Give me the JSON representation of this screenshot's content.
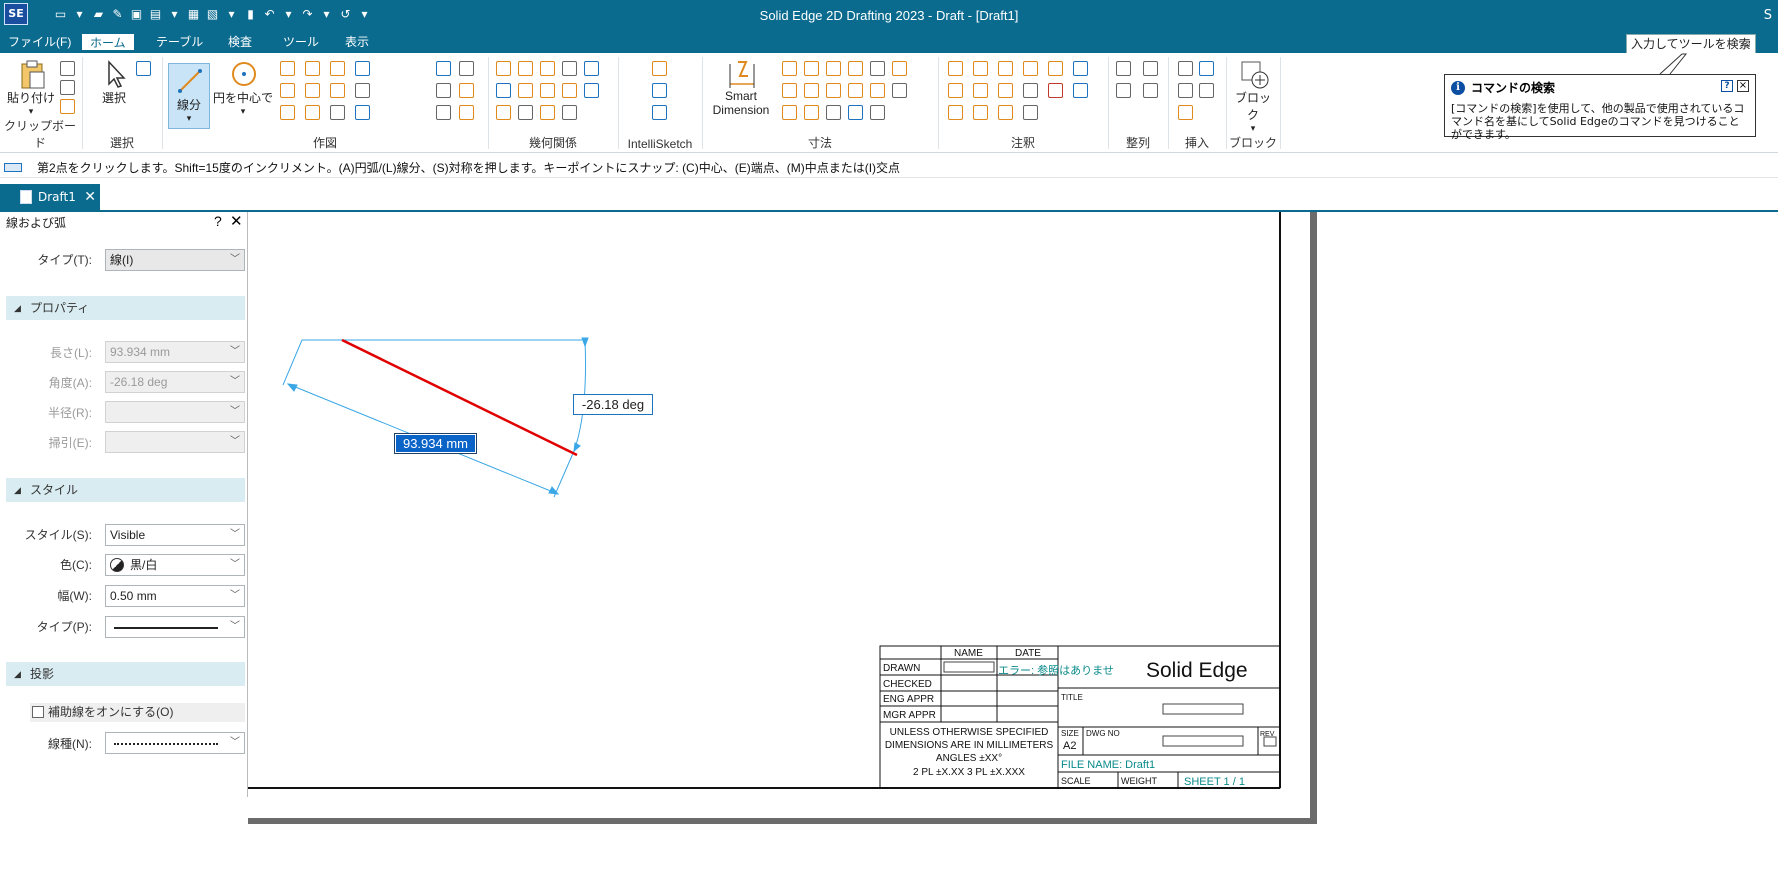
{
  "app": {
    "logo": "SE",
    "title": "Solid Edge 2D Drafting 2023 - Draft - [Draft1]",
    "edge_letter": "S",
    "search_placeholder": "入力してツールを検索",
    "search_icon": "magnifier-icon"
  },
  "quick_access": [
    "new-icon",
    "dropdown-icon",
    "open-icon",
    "find-icon",
    "save-icon",
    "save-as-icon",
    "dropdown-icon",
    "layout-icon",
    "sheet-icon",
    "dropdown-icon",
    "book-icon",
    "undo-icon",
    "dropdown-icon",
    "redo-icon",
    "dropdown-icon",
    "repeat-icon",
    "customize-icon"
  ],
  "menu": {
    "tabs": [
      "ファイル(F)",
      "ホーム",
      "テーブル",
      "検査",
      "ツール",
      "表示"
    ],
    "active": "ホーム"
  },
  "ribbon": {
    "groups": [
      {
        "label": "クリップボード",
        "button": "貼り付け"
      },
      {
        "label": "選択",
        "button": "選択"
      },
      {
        "label": "作図",
        "buttons": [
          "線分",
          "円を中心で"
        ]
      },
      {
        "label": "幾何関係"
      },
      {
        "label": "IntelliSketch"
      },
      {
        "label": "寸法",
        "button": "Smart Dimension"
      },
      {
        "label": "注釈"
      },
      {
        "label": "整列"
      },
      {
        "label": "挿入"
      },
      {
        "label": "ブロック",
        "button": "ブロック"
      }
    ]
  },
  "command_help": {
    "title": "コマンドの検索",
    "body": "[コマンドの検索]を使用して、他の製品で使用されているコマンド名を基にしてSolid Edgeのコマンドを見つけることができます。"
  },
  "prompt": "第2点をクリックします。Shift=15度のインクリメント。(A)円弧/(L)線分、(S)対称を押します。キーポイントにスナップ: (C)中心、(E)端点、(M)中点または(I)交点",
  "doc_tab": {
    "label": "Draft1",
    "close": "✕"
  },
  "panel": {
    "title": "線および弧",
    "help": "?",
    "close": "✕",
    "type_label": "タイプ(T):",
    "type_value": "線(I)",
    "sections": {
      "properties": "プロパティ",
      "style": "スタイル",
      "projection": "投影"
    },
    "length_label": "長さ(L):",
    "length_value": "93.934 mm",
    "angle_label": "角度(A):",
    "angle_value": "-26.18 deg",
    "radius_label": "半径(R):",
    "sweep_label": "掃引(E):",
    "style_label": "スタイル(S):",
    "style_value": "Visible",
    "color_label": "色(C):",
    "color_value": "黒/白",
    "width_label": "幅(W):",
    "width_value": "0.50 mm",
    "linetype_label": "タイプ(P):",
    "projection_check": "補助線をオンにする(O)",
    "projection_type_label": "線種(N):"
  },
  "drawing": {
    "dim_length": "93.934 mm",
    "dim_angle": "-26.18 deg",
    "line_color": "#e00000",
    "dim_color": "#3aa7e6"
  },
  "title_block": {
    "name_header": "NAME",
    "date_header": "DATE",
    "rows": [
      "DRAWN",
      "CHECKED",
      "ENG APPR",
      "MGR APPR"
    ],
    "error_text": "エラー: 参照はありませ",
    "brand": "Solid Edge",
    "title_label": "TITLE",
    "notes": [
      "UNLESS OTHERWISE SPECIFIED",
      "DIMENSIONS ARE IN MILLIMETERS",
      "ANGLES ±XX°",
      "2 PL ±X.XX 3 PL ±X.XXX"
    ],
    "size_label": "SIZE",
    "size_value": "A2",
    "dwg_no_label": "DWG NO",
    "rev_label": "REV",
    "file_name": "FILE NAME: Draft1",
    "scale_label": "SCALE",
    "weight_label": "WEIGHT",
    "sheet": "SHEET 1 / 1"
  }
}
